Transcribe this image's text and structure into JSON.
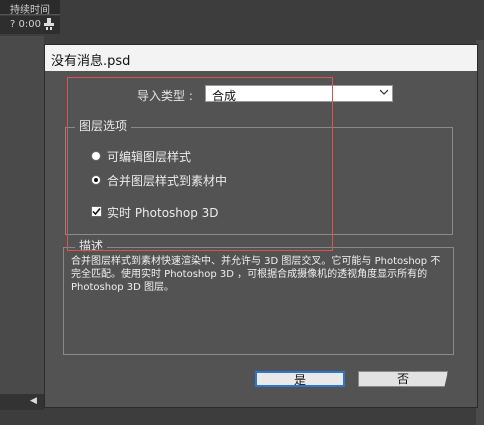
{
  "background": {
    "timeline_header": "持续时间",
    "timecode": "? 0:00",
    "collapse_arrow": "◀"
  },
  "dialog": {
    "title": "没有消息.psd",
    "import_type_label": "导入类型 :",
    "import_type_value": "合成",
    "layer_options_title": "图层选项",
    "radio_editable": "可编辑图层样式",
    "radio_merge": "合并图层样式到素材中",
    "live_3d_label": "实时 Photoshop 3D",
    "description_title": "描述",
    "description_text": "合并图层样式到素材快速渲染中、并允许与 3D 图层交叉。它可能与 Photoshop 不完全匹配。使用实时 Photoshop 3D ，可根据合成摄像机的透视角度显示所有的 Photoshop 3D 图层。",
    "yes_button": "是",
    "no_button": "否",
    "selected_radio": "merge",
    "live_3d_checked": true
  },
  "colors": {
    "dialog_bg": "#535353",
    "accent_border": "#2f76c9",
    "highlight_rect": "#d9534f"
  }
}
